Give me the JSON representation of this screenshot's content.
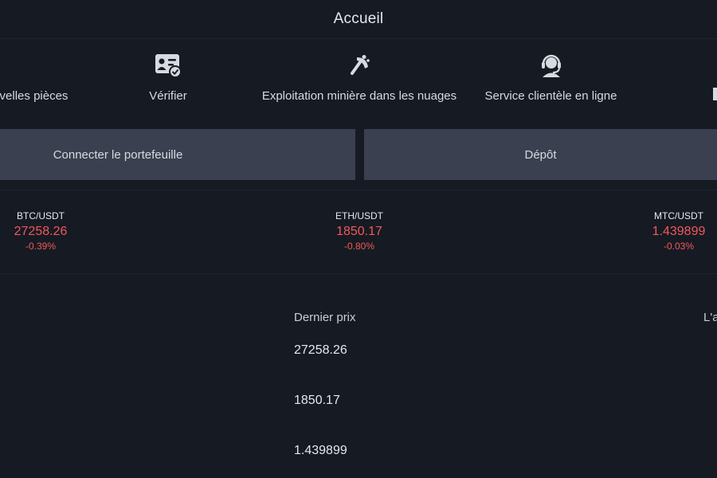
{
  "header": {
    "title": "Accueil"
  },
  "quick_actions": [
    {
      "label": "velles pièces",
      "icon": "new-coins-icon"
    },
    {
      "label": "Vérifier",
      "icon": "id-card-verify-icon"
    },
    {
      "label": "Exploitation minière dans les nuages",
      "icon": "cloud-mining-icon"
    },
    {
      "label": "Service clientèle en ligne",
      "icon": "headset-support-icon"
    }
  ],
  "buttons": {
    "connect_wallet": "Connecter le portefeuille",
    "deposit": "Dépôt"
  },
  "tickers": [
    {
      "pair": "BTC/USDT",
      "price": "27258.26",
      "change": "-0.39%"
    },
    {
      "pair": "ETH/USDT",
      "price": "1850.17",
      "change": "-0.80%"
    },
    {
      "pair": "MTC/USDT",
      "price": "1.439899",
      "change": "-0.03%"
    }
  ],
  "market_table": {
    "columns": [
      "Dernier prix",
      "L'a"
    ],
    "rows": [
      {
        "last_price": "27258.26"
      },
      {
        "last_price": "1850.17"
      },
      {
        "last_price": "1.439899"
      }
    ]
  },
  "colors": {
    "negative": "#f0585d",
    "button_bg": "#3b4050",
    "page_bg": "#161a22"
  }
}
